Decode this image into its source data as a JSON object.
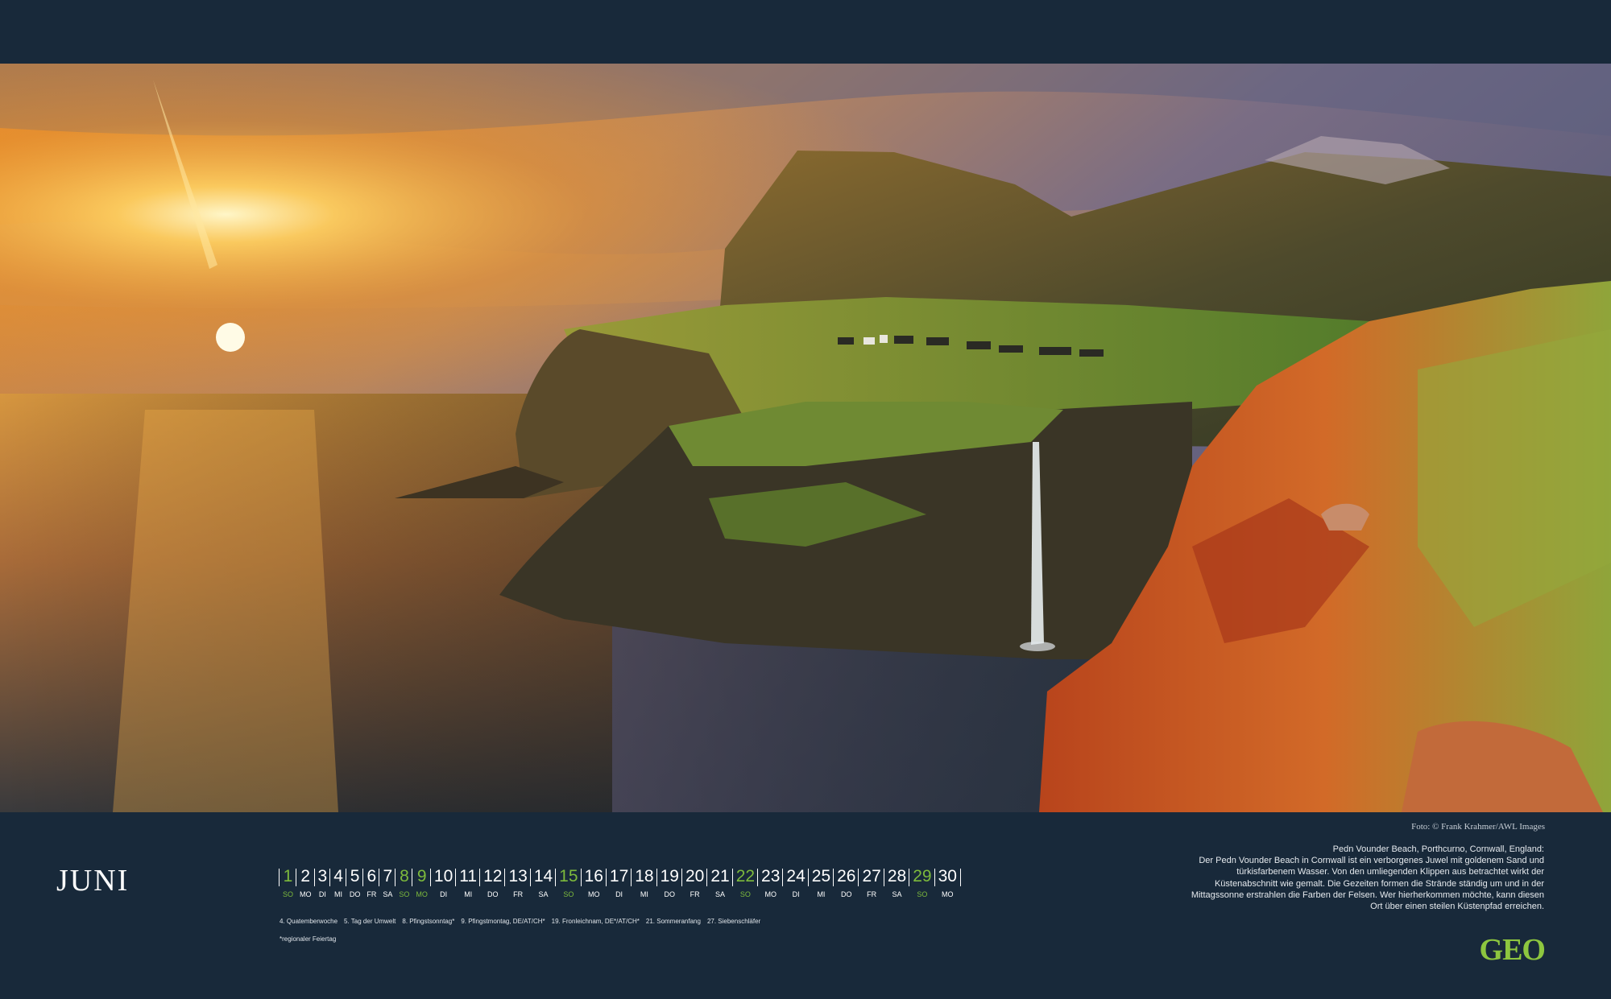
{
  "photo": {
    "alt": "Coastal cliffs with waterfall at sunset"
  },
  "credit": "Foto: © Frank Krahmer/AWL Images",
  "month": "JUNI",
  "days": [
    {
      "num": "1",
      "wd": "SO",
      "type": "sun"
    },
    {
      "num": "2",
      "wd": "MO",
      "type": ""
    },
    {
      "num": "3",
      "wd": "DI",
      "type": ""
    },
    {
      "num": "4",
      "wd": "MI",
      "type": ""
    },
    {
      "num": "5",
      "wd": "DO",
      "type": ""
    },
    {
      "num": "6",
      "wd": "FR",
      "type": ""
    },
    {
      "num": "7",
      "wd": "SA",
      "type": ""
    },
    {
      "num": "8",
      "wd": "SO",
      "type": "sun"
    },
    {
      "num": "9",
      "wd": "MO",
      "type": "hol"
    },
    {
      "num": "10",
      "wd": "DI",
      "type": ""
    },
    {
      "num": "11",
      "wd": "MI",
      "type": ""
    },
    {
      "num": "12",
      "wd": "DO",
      "type": ""
    },
    {
      "num": "13",
      "wd": "FR",
      "type": ""
    },
    {
      "num": "14",
      "wd": "SA",
      "type": ""
    },
    {
      "num": "15",
      "wd": "SO",
      "type": "sun"
    },
    {
      "num": "16",
      "wd": "MO",
      "type": ""
    },
    {
      "num": "17",
      "wd": "DI",
      "type": ""
    },
    {
      "num": "18",
      "wd": "MI",
      "type": ""
    },
    {
      "num": "19",
      "wd": "DO",
      "type": ""
    },
    {
      "num": "20",
      "wd": "FR",
      "type": ""
    },
    {
      "num": "21",
      "wd": "SA",
      "type": ""
    },
    {
      "num": "22",
      "wd": "SO",
      "type": "sun"
    },
    {
      "num": "23",
      "wd": "MO",
      "type": ""
    },
    {
      "num": "24",
      "wd": "DI",
      "type": ""
    },
    {
      "num": "25",
      "wd": "MI",
      "type": ""
    },
    {
      "num": "26",
      "wd": "DO",
      "type": ""
    },
    {
      "num": "27",
      "wd": "FR",
      "type": ""
    },
    {
      "num": "28",
      "wd": "SA",
      "type": ""
    },
    {
      "num": "29",
      "wd": "SO",
      "type": "sun"
    },
    {
      "num": "30",
      "wd": "MO",
      "type": ""
    }
  ],
  "holidays": [
    "4. Quatemberwoche",
    "5. Tag der Umwelt",
    "8. Pfingstsonntag*",
    "9. Pfingstmontag, DE/AT/CH*",
    "19. Fronleichnam, DE*/AT/CH*",
    "21. Sommeranfang",
    "27. Siebenschläfer"
  ],
  "note": "*regionaler Feiertag",
  "caption": {
    "title": "Pedn Vounder Beach, Porthcurno, Cornwall, England:",
    "body": "Der Pedn Vounder Beach in Cornwall ist ein verborgenes Juwel mit goldenem Sand und türkisfarbenem Wasser. Von den umliegenden Klippen aus betrachtet wirkt der Küstenabschnitt wie gemalt. Die Gezeiten formen die Strände ständig um und in der Mittagssonne erstrahlen die Farben der Felsen. Wer hierherkommen möchte, kann diesen Ort über einen steilen Küstenpfad erreichen."
  },
  "logo": "GEO",
  "colors": {
    "background": "#18293a",
    "accent": "#7dba3c",
    "logo": "#8dc63f"
  }
}
